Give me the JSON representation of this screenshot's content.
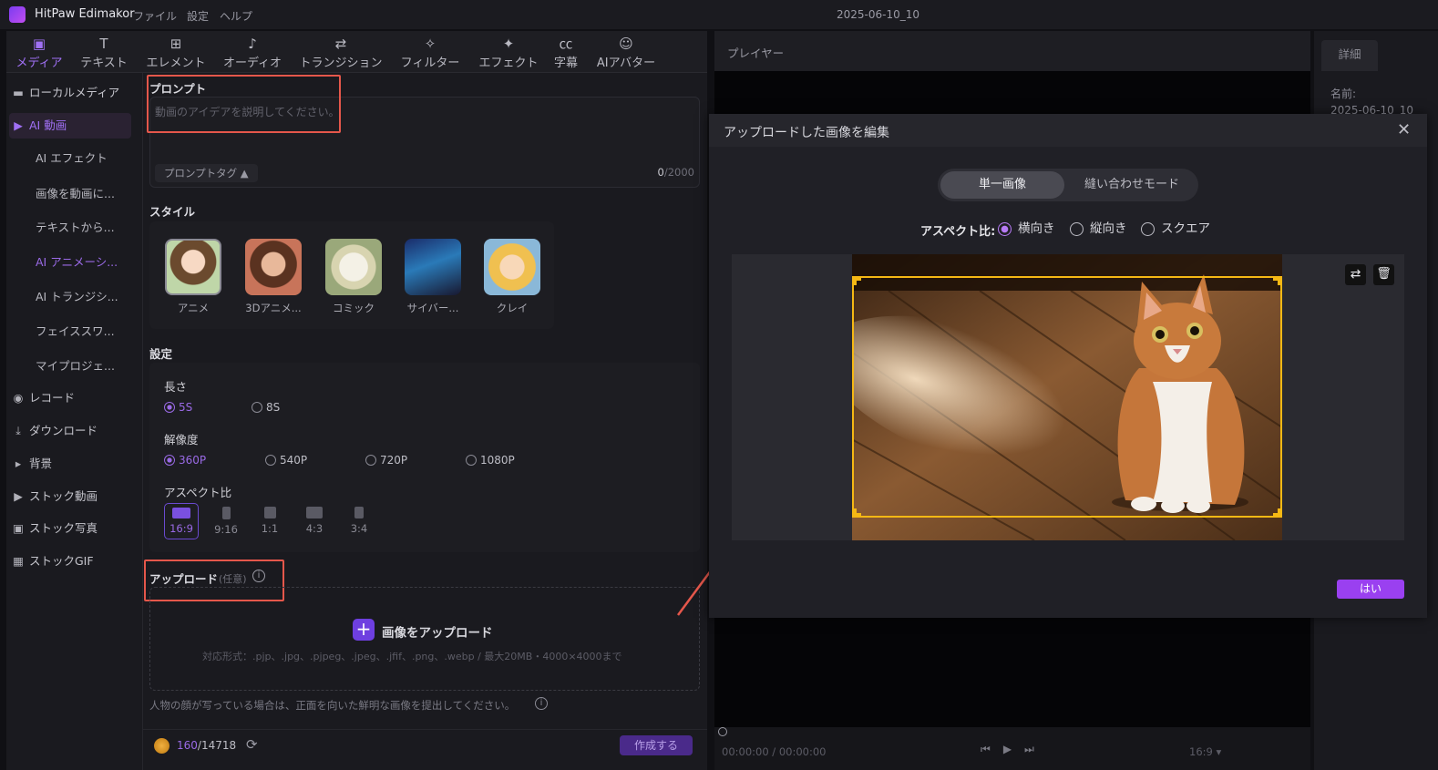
{
  "titlebar": {
    "app": "HitPaw Edimakor",
    "menus": [
      "ファイル",
      "設定",
      "ヘルプ"
    ],
    "project": "2025-06-10_10"
  },
  "tabs": [
    {
      "label": "メディア",
      "icon": "media-icon"
    },
    {
      "label": "テキスト",
      "icon": "text-icon"
    },
    {
      "label": "エレメント",
      "icon": "element-icon"
    },
    {
      "label": "オーディオ",
      "icon": "audio-icon"
    },
    {
      "label": "トランジション",
      "icon": "transition-icon"
    },
    {
      "label": "フィルター",
      "icon": "filter-icon"
    },
    {
      "label": "エフェクト",
      "icon": "effect-icon"
    },
    {
      "label": "字幕",
      "icon": "subtitle-icon"
    },
    {
      "label": "AIアバター",
      "icon": "avatar-icon"
    }
  ],
  "sidebar": [
    {
      "label": "ローカルメディア"
    },
    {
      "label": "AI 動画"
    },
    {
      "label": "AI エフェクト"
    },
    {
      "label": "画像を動画に..."
    },
    {
      "label": "テキストから..."
    },
    {
      "label": "AI アニメーシ..."
    },
    {
      "label": "AI トランジシ..."
    },
    {
      "label": "フェイススワ..."
    },
    {
      "label": "マイプロジェ..."
    },
    {
      "label": "レコード"
    },
    {
      "label": "ダウンロード"
    },
    {
      "label": "背景"
    },
    {
      "label": "ストック動画"
    },
    {
      "label": "ストック写真"
    },
    {
      "label": "ストックGIF"
    }
  ],
  "prompt": {
    "title": "プロンプト",
    "placeholder": "動画のアイデアを説明してください。",
    "tag": "プロンプトタグ ▲",
    "count": "0",
    "max": "/2000"
  },
  "style": {
    "title": "スタイル",
    "items": [
      "アニメ",
      "3Dアニメ...",
      "コミック",
      "サイバー...",
      "クレイ"
    ]
  },
  "settings": {
    "title": "設定",
    "length": {
      "label": "長さ",
      "options": [
        "5S",
        "8S"
      ],
      "selected": "5S"
    },
    "resolution": {
      "label": "解像度",
      "options": [
        "360P",
        "540P",
        "720P",
        "1080P"
      ],
      "selected": "360P"
    },
    "aspect": {
      "label": "アスペクト比",
      "options": [
        "16:9",
        "9:16",
        "1:1",
        "4:3",
        "3:4"
      ],
      "selected": "16:9"
    }
  },
  "upload": {
    "title": "アップロード",
    "optional": "(任意)",
    "button": "画像をアップロード",
    "formats": "対応形式：.pjp、.jpg、.pjpeg、.jpeg、.jfif、.png、.webp / 最大20MB・4000×4000まで",
    "note": "人物の顔が写っている場合は、正面を向いた鮮明な画像を提出してください。"
  },
  "bottom": {
    "credits_used": "160",
    "credits_total": "/14718",
    "make": "作成する"
  },
  "player": {
    "title": "プレイヤー",
    "time": "00:00:00 / 00:00:00",
    "ratio": "16:9 ▾"
  },
  "details": {
    "tab": "詳細",
    "name_label": "名前:",
    "name_value": "2025-06-10_10"
  },
  "modal": {
    "title": "アップロードした画像を編集",
    "modes": [
      "単一画像",
      "縫い合わせモード"
    ],
    "aspect_label": "アスペクト比:",
    "aspect_options": [
      "横向き",
      "縦向き",
      "スクエア"
    ],
    "aspect_selected": "横向き",
    "ok": "はい"
  },
  "colors": {
    "accent": "#9a6ae6",
    "crop": "#f5b814",
    "annotation": "#e5574b",
    "ok_button": "#9a40f0"
  }
}
